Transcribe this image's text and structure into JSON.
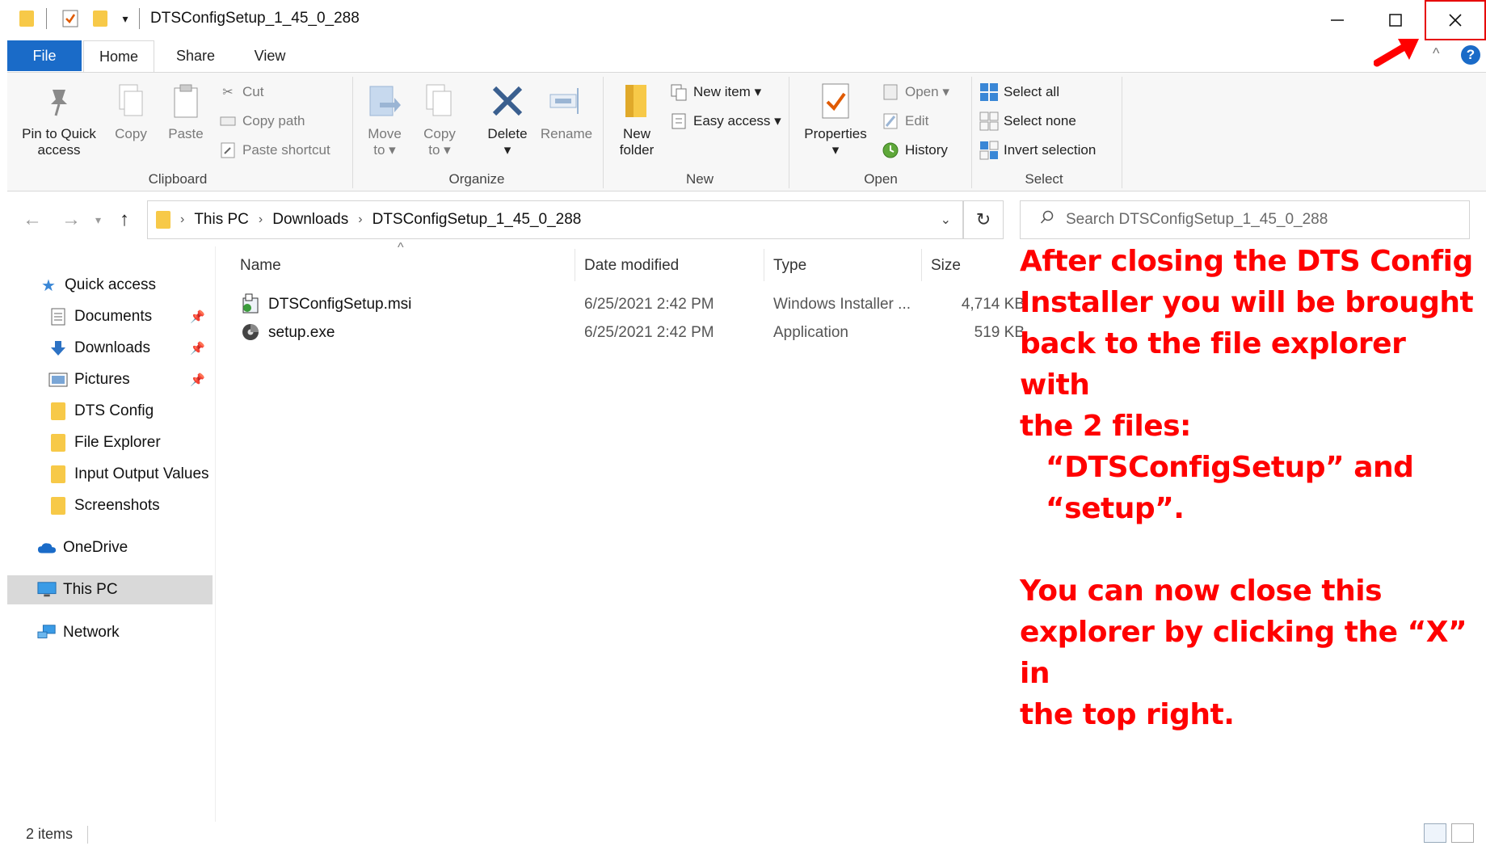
{
  "window": {
    "title": "DTSConfigSetup_1_45_0_288"
  },
  "ribbon_tabs": [
    "File",
    "Home",
    "Share",
    "View"
  ],
  "ribbon": {
    "clipboard": {
      "pin": "Pin to Quick access",
      "pin_l1": "Pin to Quick",
      "pin_l2": "access",
      "copy": "Copy",
      "paste": "Paste",
      "cut": "Cut",
      "copy_path": "Copy path",
      "paste_shortcut": "Paste shortcut",
      "label": "Clipboard"
    },
    "organize": {
      "move_l1": "Move",
      "move_l2": "to",
      "copy_l1": "Copy",
      "copy_l2": "to",
      "delete": "Delete",
      "rename": "Rename",
      "label": "Organize"
    },
    "new": {
      "folder_l1": "New",
      "folder_l2": "folder",
      "new_item": "New item",
      "easy_access": "Easy access",
      "label": "New"
    },
    "open": {
      "properties": "Properties",
      "open": "Open",
      "edit": "Edit",
      "history": "History",
      "label": "Open"
    },
    "select": {
      "select_all": "Select all",
      "select_none": "Select none",
      "invert": "Invert selection",
      "label": "Select"
    }
  },
  "address": {
    "crumbs": [
      "This PC",
      "Downloads",
      "DTSConfigSetup_1_45_0_288"
    ]
  },
  "search": {
    "placeholder": "Search DTSConfigSetup_1_45_0_288"
  },
  "nav": {
    "quick_access": "Quick access",
    "items": [
      "Documents",
      "Downloads",
      "Pictures",
      "DTS Config",
      "File Explorer",
      "Input Output Values",
      "Screenshots"
    ],
    "onedrive": "OneDrive",
    "this_pc": "This PC",
    "network": "Network"
  },
  "columns": {
    "name": "Name",
    "date": "Date modified",
    "type": "Type",
    "size": "Size"
  },
  "files": [
    {
      "name": "DTSConfigSetup.msi",
      "date": "6/25/2021 2:42 PM",
      "type": "Windows Installer ...",
      "size": "4,714 KB"
    },
    {
      "name": "setup.exe",
      "date": "6/25/2021 2:42 PM",
      "type": "Application",
      "size": "519 KB"
    }
  ],
  "annotation": {
    "p1_l1": "After closing the DTS Config",
    "p1_l2": "Installer you will be brought",
    "p1_l3": "back to the file explorer with",
    "p1_l4": "the 2 files:",
    "p1_l5": "“DTSConfigSetup” and",
    "p1_l6": "“setup”.",
    "p2_l1": "You can now close this",
    "p2_l2": "explorer by clicking the “X” in",
    "p2_l3": "the top right."
  },
  "status": {
    "count": "2 items"
  },
  "colors": {
    "accent": "#1a6bc8",
    "annotation": "#ff0000",
    "folder": "#f7c948"
  }
}
